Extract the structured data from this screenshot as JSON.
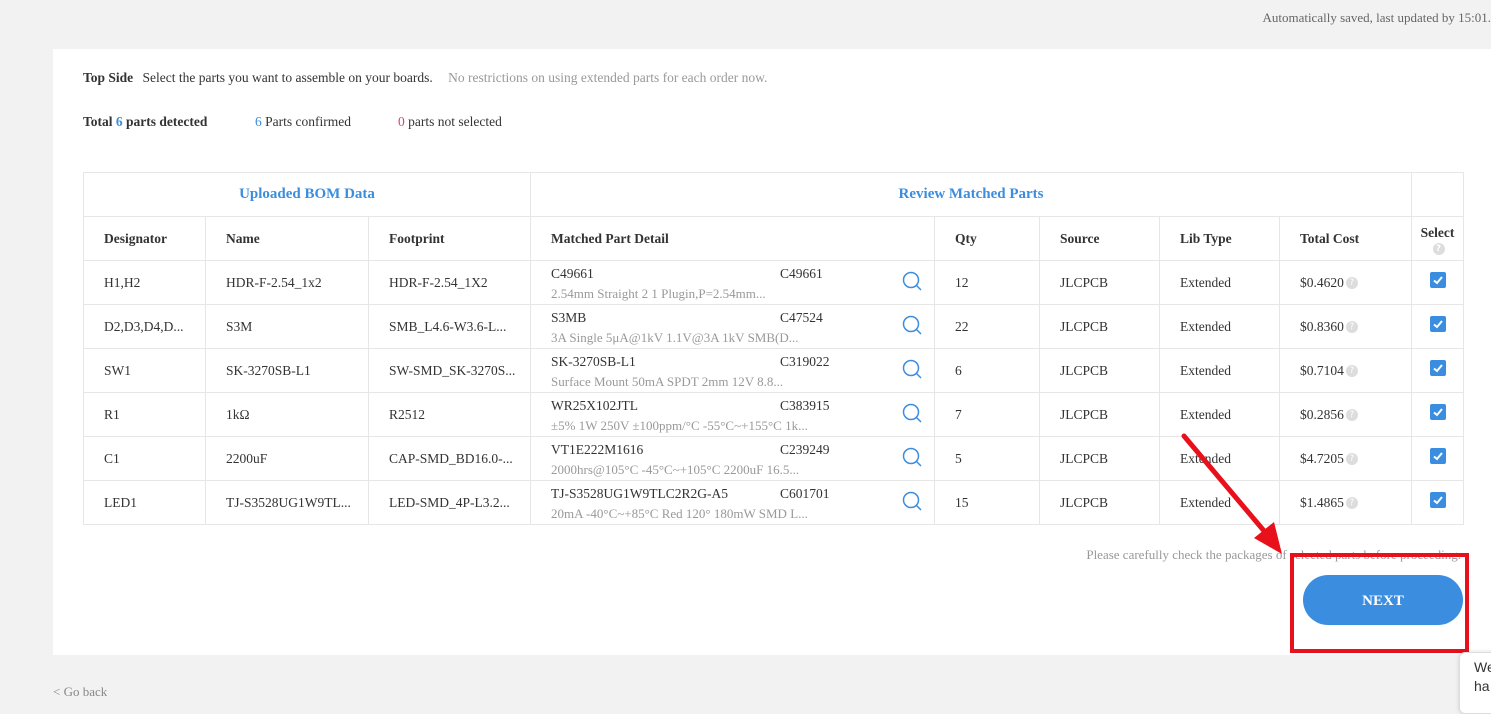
{
  "autosave_text": "Automatically saved, last updated by 15:01.",
  "top_side": {
    "label": "Top Side",
    "instruction": "Select the parts you want to assemble on your boards.",
    "note": "No restrictions on using extended parts for each order now."
  },
  "summary": {
    "total_prefix": "Total",
    "total_count": "6",
    "total_suffix": "parts detected",
    "confirmed_count": "6",
    "confirmed_label": "Parts confirmed",
    "not_selected_count": "0",
    "not_selected_label": "parts not selected"
  },
  "table": {
    "group_left": "Uploaded BOM Data",
    "group_right": "Review Matched Parts",
    "headers": {
      "designator": "Designator",
      "name": "Name",
      "footprint": "Footprint",
      "matched": "Matched Part Detail",
      "qty": "Qty",
      "source": "Source",
      "libtype": "Lib Type",
      "cost": "Total Cost",
      "select": "Select"
    },
    "rows": [
      {
        "designator": "H1,H2",
        "name": "HDR-F-2.54_1x2",
        "footprint": "HDR-F-2.54_1X2",
        "part": "C49661",
        "code": "C49661",
        "desc": "2.54mm Straight 2 1 Plugin,P=2.54mm...",
        "qty": "12",
        "source": "JLCPCB",
        "libtype": "Extended",
        "cost": "$0.4620"
      },
      {
        "designator": "D2,D3,D4,D...",
        "name": "S3M",
        "footprint": "SMB_L4.6-W3.6-L...",
        "part": "S3MB",
        "code": "C47524",
        "desc": "3A Single 5μA@1kV 1.1V@3A 1kV SMB(D...",
        "qty": "22",
        "source": "JLCPCB",
        "libtype": "Extended",
        "cost": "$0.8360"
      },
      {
        "designator": "SW1",
        "name": "SK-3270SB-L1",
        "footprint": "SW-SMD_SK-3270S...",
        "part": "SK-3270SB-L1",
        "code": "C319022",
        "desc": "Surface Mount 50mA SPDT 2mm 12V 8.8...",
        "qty": "6",
        "source": "JLCPCB",
        "libtype": "Extended",
        "cost": "$0.7104"
      },
      {
        "designator": "R1",
        "name": "1kΩ",
        "footprint": "R2512",
        "part": "WR25X102JTL",
        "code": "C383915",
        "desc": "±5% 1W 250V ±100ppm/°C -55°C~+155°C 1k...",
        "qty": "7",
        "source": "JLCPCB",
        "libtype": "Extended",
        "cost": "$0.2856"
      },
      {
        "designator": "C1",
        "name": "2200uF",
        "footprint": "CAP-SMD_BD16.0-...",
        "part": "VT1E222M1616",
        "code": "C239249",
        "desc": "2000hrs@105°C -45°C~+105°C 2200uF 16.5...",
        "qty": "5",
        "source": "JLCPCB",
        "libtype": "Extended",
        "cost": "$4.7205"
      },
      {
        "designator": "LED1",
        "name": "TJ-S3528UG1W9TL...",
        "footprint": "LED-SMD_4P-L3.2...",
        "part": "TJ-S3528UG1W9TLC2R2G-A5",
        "code": "C601701",
        "desc": "20mA -40°C~+85°C Red 120° 180mW SMD L...",
        "qty": "15",
        "source": "JLCPCB",
        "libtype": "Extended",
        "cost": "$1.4865"
      }
    ]
  },
  "notice": "Please carefully check the packages of selected parts before proceeding.",
  "next_label": "NEXT",
  "go_back": "< Go back",
  "chat_widget": "We\nha",
  "colors": {
    "accent": "#3b8ddf",
    "highlight": "#e8101a",
    "danger": "#e0406a"
  }
}
